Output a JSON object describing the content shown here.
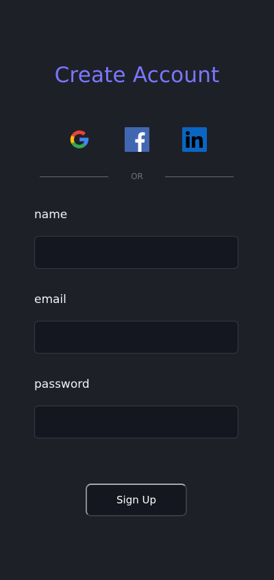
{
  "header": {
    "title": "Create Account"
  },
  "social": [
    {
      "icon": "google-icon",
      "label": "Google"
    },
    {
      "icon": "facebook-icon",
      "label": "Facebook"
    },
    {
      "icon": "linkedin-icon",
      "label": "LinkedIn"
    }
  ],
  "divider": {
    "text": "OR"
  },
  "form": {
    "name": {
      "label": "name",
      "value": "",
      "placeholder": ""
    },
    "email": {
      "label": "email",
      "value": "",
      "placeholder": ""
    },
    "password": {
      "label": "password",
      "value": "",
      "placeholder": ""
    },
    "submit_label": "Sign Up"
  },
  "colors": {
    "background": "#1e2028",
    "title": "#7b77ff",
    "input_background": "#151720",
    "google_blue": "#4285F4",
    "google_red": "#EA4335",
    "google_yellow": "#FBBC05",
    "google_green": "#34A853",
    "facebook": "#4267B2",
    "linkedin": "#0A66C2"
  }
}
